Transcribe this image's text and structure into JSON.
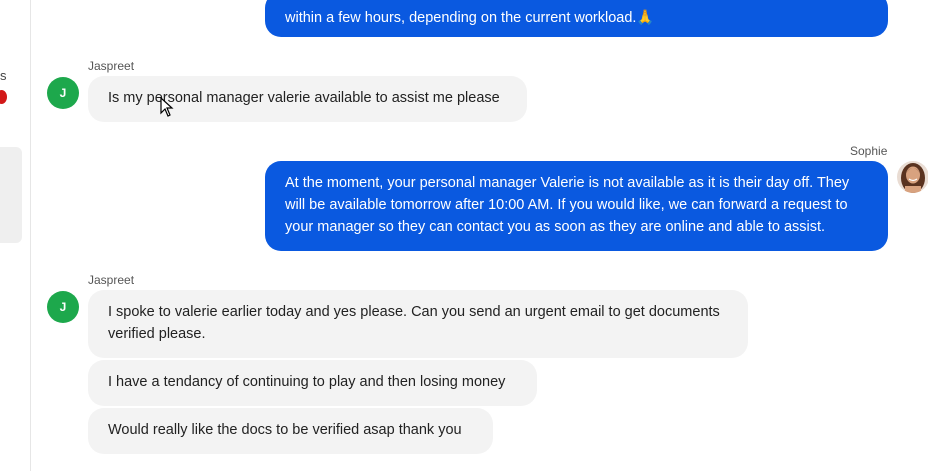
{
  "sidebar": {
    "fragment_text": "s"
  },
  "messages": [
    {
      "sender": "",
      "text": "within a few hours, depending on the current workload.🙏"
    },
    {
      "sender": "Jaspreet",
      "avatar": "J",
      "text": "Is my personal manager valerie available to assist me please"
    },
    {
      "sender": "Sophie",
      "text": "At the moment, your personal manager Valerie is not available as it is their day off. They will be available tomorrow after 10:00 AM. If you would like, we can forward a request to your manager so they can contact you as soon as they are online and able to assist."
    },
    {
      "sender": "Jaspreet",
      "avatar": "J",
      "text": "I spoke to valerie earlier today and yes please. Can you send an urgent email to get documents verified please."
    },
    {
      "text": "I have a tendancy of continuing to play and then losing money"
    },
    {
      "text": "Would really like the docs to be verified asap thank you"
    }
  ],
  "colors": {
    "agent_bubble": "#0a59e0",
    "user_bubble": "#f3f3f3",
    "user_avatar": "#1da84c"
  }
}
